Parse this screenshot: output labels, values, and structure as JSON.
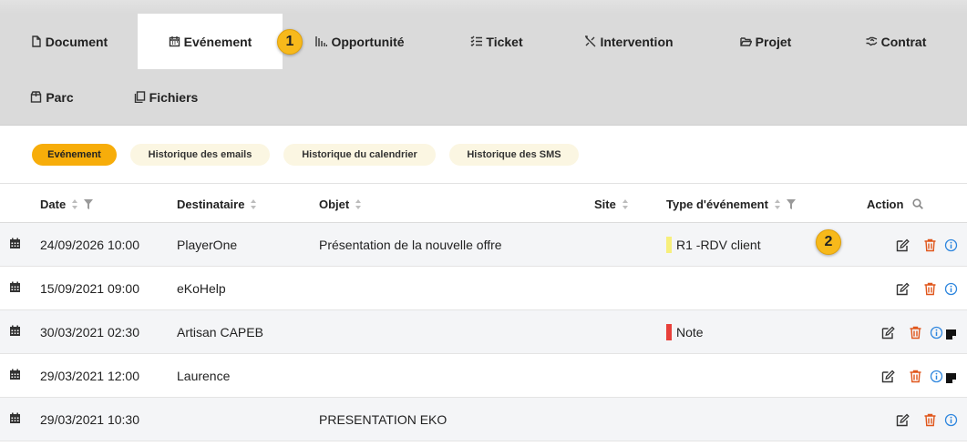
{
  "tabs": [
    {
      "label": "Document",
      "icon": "document-icon",
      "active": false
    },
    {
      "label": "Evénement",
      "icon": "calendar-icon",
      "active": true
    },
    {
      "label": "Opportunité",
      "icon": "bar-chart-icon",
      "active": false
    },
    {
      "label": "Ticket",
      "icon": "checklist-icon",
      "active": false
    },
    {
      "label": "Intervention",
      "icon": "tools-icon",
      "active": false
    },
    {
      "label": "Projet",
      "icon": "folder-open-icon",
      "active": false
    },
    {
      "label": "Contrat",
      "icon": "handshake-icon",
      "active": false
    },
    {
      "label": "Parc",
      "icon": "box-icon",
      "active": false
    },
    {
      "label": "Fichiers",
      "icon": "files-icon",
      "active": false
    }
  ],
  "markers": {
    "one": "1",
    "two": "2"
  },
  "subtabs": [
    {
      "label": "Evénement",
      "active": true
    },
    {
      "label": "Historique des emails",
      "active": false
    },
    {
      "label": "Historique du calendrier",
      "active": false
    },
    {
      "label": "Historique des SMS",
      "active": false
    }
  ],
  "table": {
    "columns": {
      "date": "Date",
      "recipient": "Destinataire",
      "object": "Objet",
      "site": "Site",
      "type": "Type d'événement",
      "action": "Action"
    },
    "rows": [
      {
        "date": "24/09/2026 10:00",
        "recipient": "PlayerOne",
        "object": "Présentation de la nouvelle offre",
        "site": "",
        "type": "R1 -RDV client",
        "type_color": "#f7ef7c",
        "note": false
      },
      {
        "date": "15/09/2021 09:00",
        "recipient": "eKoHelp",
        "object": "",
        "site": "",
        "type": "",
        "type_color": "",
        "note": false
      },
      {
        "date": "30/03/2021 02:30",
        "recipient": "Artisan CAPEB",
        "object": "",
        "site": "",
        "type": "Note",
        "type_color": "#e8403a",
        "note": true
      },
      {
        "date": "29/03/2021 12:00",
        "recipient": "Laurence",
        "object": "",
        "site": "",
        "type": "",
        "type_color": "",
        "note": true
      },
      {
        "date": "29/03/2021 10:30",
        "recipient": "",
        "object": "PRESENTATION EKO",
        "site": "",
        "type": "",
        "type_color": "",
        "note": false
      }
    ]
  },
  "colors": {
    "accent": "#f7ad0a",
    "tabbar_bg": "#dadada",
    "delete": "#e0561b",
    "info": "#2e86de"
  }
}
